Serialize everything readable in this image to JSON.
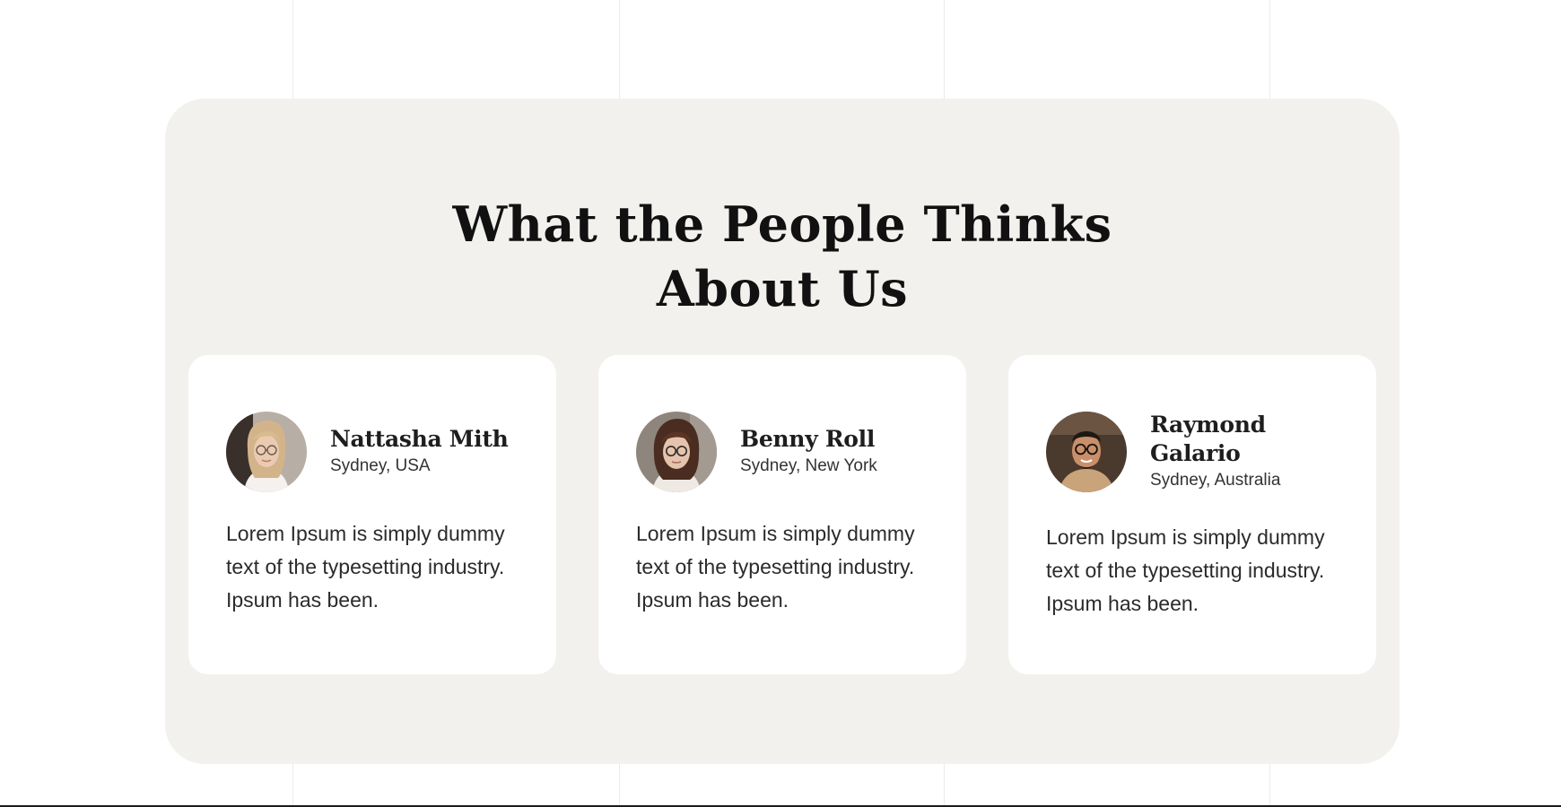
{
  "section": {
    "heading_line1": "What the People Thinks",
    "heading_line2": "About Us"
  },
  "testimonials": [
    {
      "name": "Nattasha Mith",
      "location": "Sydney, USA",
      "quote": "Lorem Ipsum is simply dummy text of the typesetting industry. Ipsum has been.",
      "avatar_icon": "portrait-woman-blonde-glasses"
    },
    {
      "name": "Benny Roll",
      "location": "Sydney, New York",
      "quote": "Lorem Ipsum is simply dummy text of the typesetting industry. Ipsum has been.",
      "avatar_icon": "portrait-woman-brunette-glasses"
    },
    {
      "name": "Raymond Galario",
      "location": "Sydney, Australia",
      "quote": "Lorem Ipsum is simply dummy text of the typesetting industry. Ipsum has been.",
      "avatar_icon": "portrait-man-beard-glasses"
    }
  ],
  "colors": {
    "page_background": "#ffffff",
    "panel_background": "#f3f1ee",
    "card_background": "#ffffff",
    "heading_text": "#111111",
    "body_text": "#2b2b2b"
  }
}
